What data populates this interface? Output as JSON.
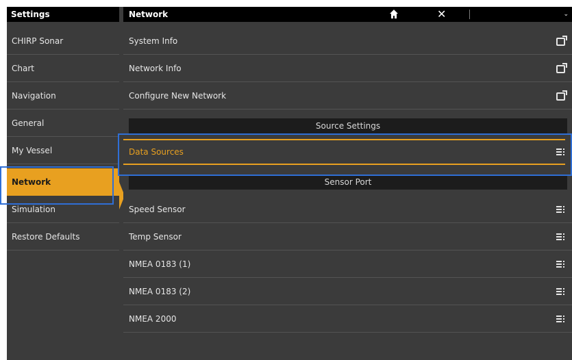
{
  "left_panel": {
    "title": "Settings",
    "items": [
      {
        "label": "CHIRP Sonar"
      },
      {
        "label": "Chart"
      },
      {
        "label": "Navigation"
      },
      {
        "label": "General"
      },
      {
        "label": "My Vessel"
      },
      {
        "label": "Network"
      },
      {
        "label": "Simulation"
      },
      {
        "label": "Restore Defaults"
      }
    ],
    "selected": "Network"
  },
  "right_panel": {
    "title": "Network",
    "header_icons": [
      "home-icon",
      "close-icon",
      "chevron-down-icon"
    ],
    "rows_top": [
      {
        "label": "System Info",
        "icon": "external-window-icon"
      },
      {
        "label": "Network Info",
        "icon": "external-window-icon"
      },
      {
        "label": "Configure New Network",
        "icon": "external-window-icon"
      }
    ],
    "section_source": "Source Settings",
    "source_rows": [
      {
        "label": "Data Sources",
        "icon": "menu-icon"
      }
    ],
    "section_sensor": "Sensor Port",
    "sensor_rows": [
      {
        "label": "Speed Sensor",
        "icon": "menu-icon"
      },
      {
        "label": "Temp Sensor",
        "icon": "menu-icon"
      },
      {
        "label": "NMEA 0183 (1)",
        "icon": "menu-icon"
      },
      {
        "label": "NMEA 0183 (2)",
        "icon": "menu-icon"
      },
      {
        "label": "NMEA 2000",
        "icon": "menu-icon"
      }
    ]
  },
  "colors": {
    "accent": "#e8a020",
    "background": "#3b3b3b",
    "header": "#000000",
    "section_bar": "#1c1c1c",
    "highlight_box": "#2f6fd6"
  }
}
